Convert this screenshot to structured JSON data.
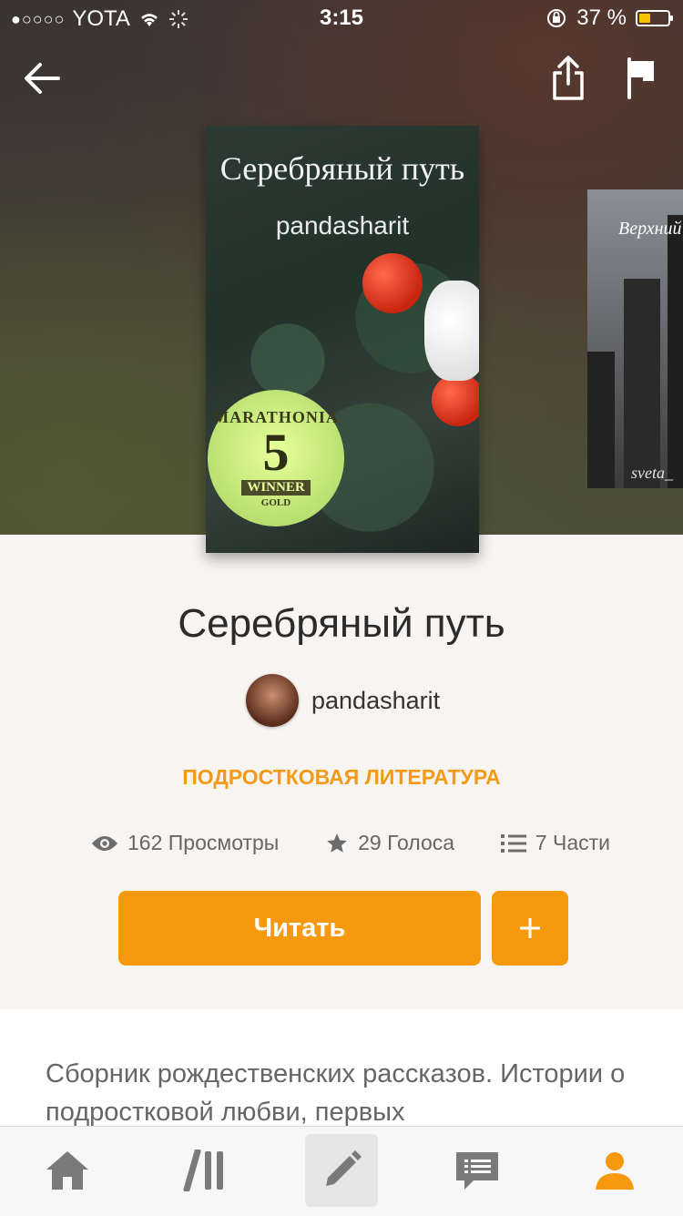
{
  "status": {
    "carrier": "YOTA",
    "time": "3:15",
    "battery": "37 %",
    "battery_level": 0.37
  },
  "cover": {
    "title": "Серебряный путь",
    "author": "pandasharit",
    "badge": {
      "line1": "MARATHONIA",
      "number": "5",
      "line2": "WINNER",
      "line3": "GOLD"
    }
  },
  "next_cover": {
    "title": "Верхний",
    "author": "sveta_"
  },
  "story": {
    "title": "Серебряный путь",
    "author": "pandasharit",
    "genre": "ПОДРОСТКОВАЯ ЛИТЕРАТУРА",
    "stats": {
      "views": "162 Просмотры",
      "votes": "29 Голоса",
      "parts": "7 Части"
    },
    "read_label": "Читать",
    "add_label": "+",
    "description": "Сборник рождественских рассказов. Истории о подростковой любви, первых"
  },
  "colors": {
    "accent": "#f6990f",
    "genre": "#f49a17"
  },
  "tabs": [
    "home-icon",
    "library-icon",
    "write-icon",
    "messages-icon",
    "profile-icon"
  ]
}
